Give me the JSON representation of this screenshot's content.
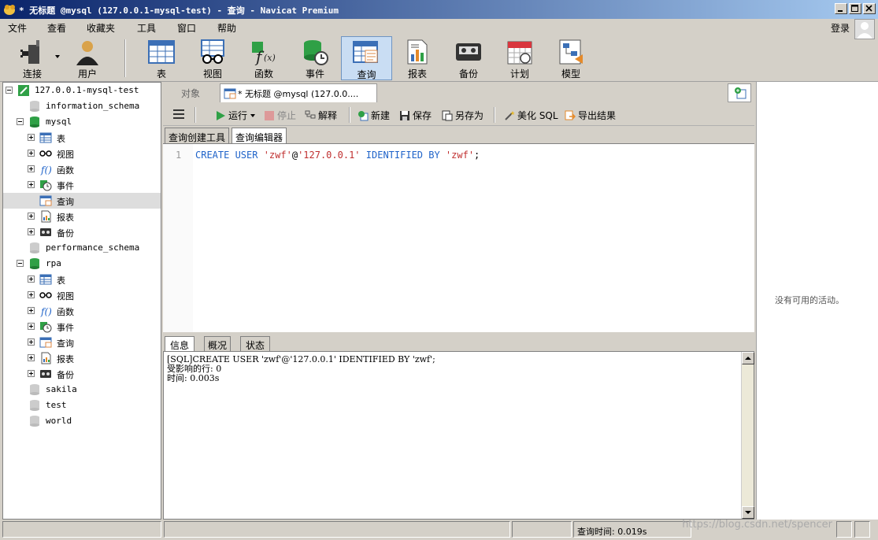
{
  "window": {
    "title": "* 无标题 @mysql (127.0.0.1-mysql-test) - 查询 - Navicat Premium",
    "colors": {
      "titlebar_start": "#0a246a",
      "titlebar_end": "#a6caf0",
      "active_toolbar": "#c9ddf3"
    }
  },
  "menu": {
    "items": [
      "文件",
      "查看",
      "收藏夹",
      "工具",
      "窗口",
      "帮助"
    ],
    "login": "登录"
  },
  "toolbar": {
    "items": [
      {
        "label": "连接",
        "icon": "plug-icon"
      },
      {
        "label": "用户",
        "icon": "user-icon"
      },
      {
        "label": "表",
        "icon": "table-icon"
      },
      {
        "label": "视图",
        "icon": "glasses-icon"
      },
      {
        "label": "函数",
        "icon": "function-icon"
      },
      {
        "label": "事件",
        "icon": "event-clock-icon"
      },
      {
        "label": "查询",
        "icon": "query-icon",
        "active": true
      },
      {
        "label": "报表",
        "icon": "report-icon"
      },
      {
        "label": "备份",
        "icon": "backup-tape-icon"
      },
      {
        "label": "计划",
        "icon": "calendar-icon"
      },
      {
        "label": "模型",
        "icon": "model-icon"
      }
    ]
  },
  "nav": {
    "connection": "127.0.0.1-mysql-test",
    "databases": {
      "information_schema": "information_schema",
      "mysql": "mysql",
      "performance_schema": "performance_schema",
      "rpa": "rpa",
      "sakila": "sakila",
      "test": "test",
      "world": "world"
    },
    "groups": {
      "tables": "表",
      "views": "视图",
      "functions": "函数",
      "events": "事件",
      "queries": "查询",
      "reports": "报表",
      "backups": "备份"
    }
  },
  "tabs": {
    "object": "对象",
    "query": "* 无标题 @mysql (127.0.0...."
  },
  "query_toolbar": {
    "run": "运行",
    "stop": "停止",
    "explain": "解释",
    "new": "新建",
    "save": "保存",
    "save_as": "另存为",
    "beautify": "美化 SQL",
    "export": "导出结果"
  },
  "subtabs": {
    "builder": "查询创建工具",
    "editor": "查询编辑器"
  },
  "editor": {
    "line_number": "1",
    "tokens": {
      "kw1": "CREATE USER ",
      "str1": "'zwf'",
      "at": "@",
      "str2": "'127.0.0.1'",
      "kw2": " IDENTIFIED BY ",
      "str3": "'zwf'",
      "end": ";"
    }
  },
  "result_tabs": [
    "信息",
    "概况",
    "状态"
  ],
  "result": {
    "lines": [
      "[SQL]CREATE USER 'zwf'@'127.0.0.1' IDENTIFIED BY 'zwf';",
      "受影响的行: 0",
      "时间: 0.003s"
    ]
  },
  "activity": {
    "empty": "没有可用的活动。"
  },
  "status": {
    "query_time": "查询时间: 0.019s",
    "watermark": "https://blog.csdn.net/spencer"
  }
}
